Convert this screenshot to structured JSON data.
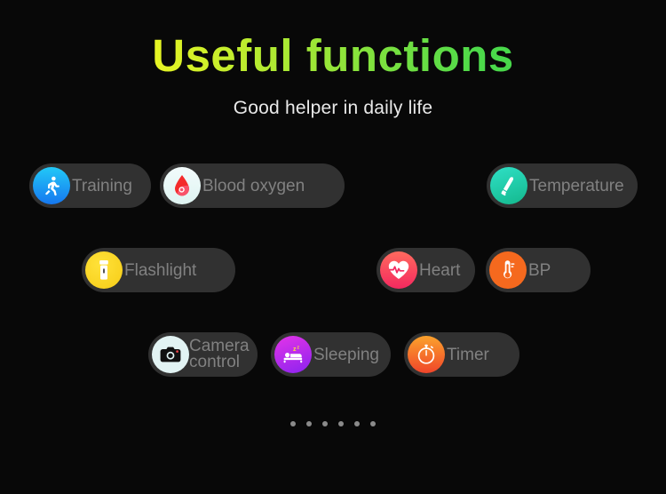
{
  "header": {
    "title": "Useful functions",
    "subtitle": "Good helper in daily life",
    "title_gradient_start": "#f4f51c",
    "title_gradient_end": "#35d74d",
    "subtitle_color": "#e9e9e9"
  },
  "page": {
    "background": "#080808",
    "pill_background": "#313131",
    "pill_label_color": "#818181"
  },
  "functions": [
    {
      "label": "Training",
      "icon": "running-person-icon",
      "icon_color": "#1677f0"
    },
    {
      "label": "Blood oxygen",
      "icon": "blood-drop-icon",
      "icon_color": "#eff9f8"
    },
    {
      "label": "Temperature",
      "icon": "thermometer-gun-icon",
      "icon_color": "#1cc9a5"
    },
    {
      "label": "Flashlight",
      "icon": "flashlight-icon",
      "icon_color": "#f6cc16"
    },
    {
      "label": "Heart",
      "icon": "heart-pulse-icon",
      "icon_color": "#f4295f"
    },
    {
      "label": "BP",
      "icon": "thermometer-icon",
      "icon_color": "#f5691e"
    },
    {
      "label": "Camera control",
      "icon": "camera-icon",
      "icon_color": "#e2f3f3"
    },
    {
      "label": "Sleeping",
      "icon": "bed-sleep-icon",
      "icon_color": "#a52bee"
    },
    {
      "label": "Timer",
      "icon": "stopwatch-icon",
      "icon_color": "#f5702a"
    }
  ],
  "pagination": {
    "dot_count": 6,
    "dot_color": "#8a8a8a"
  }
}
